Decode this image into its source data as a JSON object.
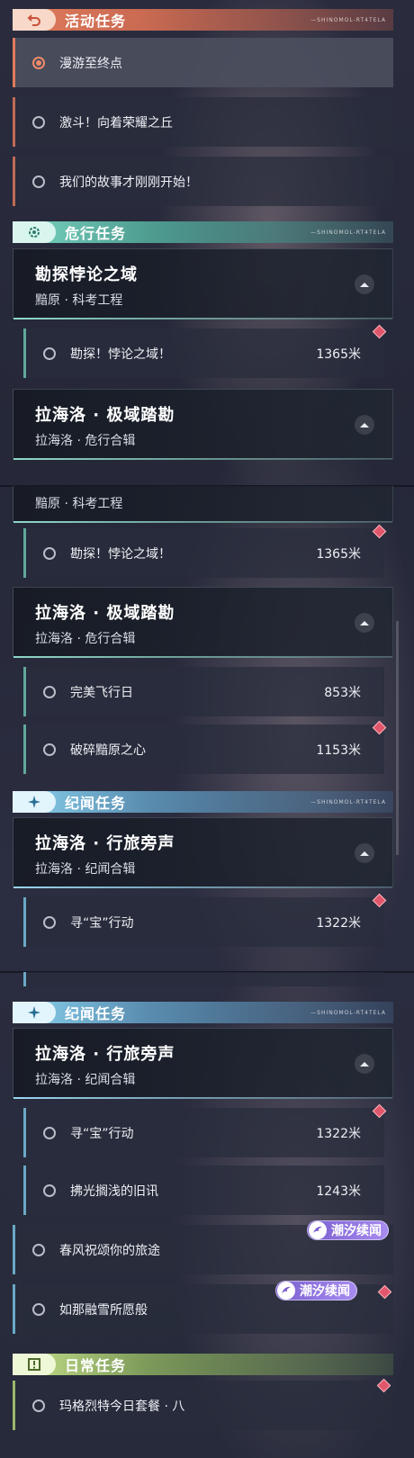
{
  "header_deco": "—SHINOMOL-RT4TELA",
  "p1": {
    "active_header": "活动任务",
    "active_quests": [
      "漫游至终点",
      "激斗！向着荣耀之丘",
      "我们的故事才刚刚开始！"
    ],
    "danger_header": "危行任务",
    "card1_title": "勘探悖论之域",
    "card1_sub": "黯原 · 科考工程",
    "card1_quest": "勘探！悖论之域！",
    "card1_dist": "1365米",
    "card2_title": "拉海洛 · 极域踏勘",
    "card2_sub": "拉海洛 · 危行合辑"
  },
  "p2": {
    "card1_sub": "黯原 · 科考工程",
    "q1": "勘探！悖论之域！",
    "q1_dist": "1365米",
    "card2_title": "拉海洛 · 极域踏勘",
    "card2_sub": "拉海洛 · 危行合辑",
    "q2": "完美飞行日",
    "q2_dist": "853米",
    "q3": "破碎黯原之心",
    "q3_dist": "1153米",
    "lore_header": "纪闻任务",
    "card3_title": "拉海洛 · 行旅旁声",
    "card3_sub": "拉海洛 · 纪闻合辑",
    "q4": "寻“宝”行动",
    "q4_dist": "1322米"
  },
  "p3": {
    "lore_header": "纪闻任务",
    "card_title": "拉海洛 · 行旅旁声",
    "card_sub": "拉海洛 · 纪闻合辑",
    "q1": "寻“宝”行动",
    "q1_dist": "1322米",
    "q2": "拂光搁浅的旧讯",
    "q2_dist": "1243米",
    "q3": "春风祝颂你的旅途",
    "q4": "如那融雪所愿般",
    "badge": "潮汐续闻",
    "daily_header": "日常任务",
    "q5": "玛格烈特今日套餐 · 八"
  },
  "colors": {
    "active": "#e07a5a",
    "danger": "#7ad6c0",
    "lore": "#8ad3ef",
    "daily": "#c7e38a",
    "gem": "#e0566b",
    "badge": "#8f74e0"
  },
  "icons": {
    "active": "return-arrow-icon",
    "danger": "gear-target-icon",
    "lore": "sparkle-icon",
    "daily": "alert-box-icon",
    "collapse": "triangle-up-icon",
    "badge": "wave-swirl-icon"
  }
}
